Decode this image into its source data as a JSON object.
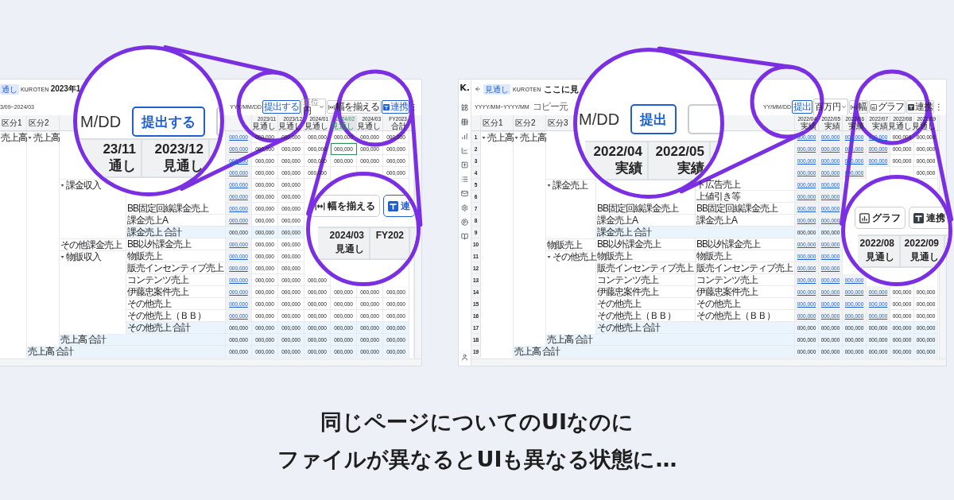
{
  "left_screen": {
    "badge": "通し",
    "company": "KUROTEN",
    "title": "2023年1",
    "period": "3/09~2024/03",
    "toolbar": {
      "date": "YYY/MM/DD",
      "submit": "提出する",
      "unit_label": "単位",
      "unit": "円",
      "buttons": [
        {
          "label": "幅を揃える",
          "kind": "align",
          "primary": false
        },
        {
          "label": "連携",
          "kind": "integration",
          "primary": true
        }
      ],
      "more": "⋮"
    },
    "label_headers": {
      "division_1": "区分1",
      "division_2": "区分2"
    },
    "columns": [
      {
        "actual": true,
        "selected": false
      },
      {
        "header": [
          "2023/11",
          "見通し"
        ],
        "actual": false,
        "selected": false
      },
      {
        "header": [
          "2023/12",
          "見通し"
        ],
        "actual": false,
        "selected": false
      },
      {
        "header": [
          "2024/01",
          "見通し"
        ],
        "actual": false,
        "selected": false
      },
      {
        "header": [
          "2024/02",
          "見通し"
        ],
        "actual": false,
        "selected": true
      },
      {
        "header": [
          "2024/03",
          "見通し"
        ],
        "actual": false,
        "selected": false
      },
      {
        "header": [
          "FY2023",
          "合計"
        ],
        "actual": false,
        "selected": false
      }
    ],
    "rows": [
      {
        "labels": {
          "division_1": {
            "text": "売上高"
          },
          "division_2": {
            "text": "売上高",
            "expanded": true
          }
        },
        "values": [
          "000,000",
          "000,000",
          "000,000",
          "000,000",
          "000,000",
          "000,000",
          "000,000"
        ],
        "total": false,
        "focused": false
      },
      {
        "values": [
          "000,000",
          "000,000",
          "000,000",
          "000,000",
          "000,000",
          "000,000",
          "000,000"
        ],
        "total": false,
        "focused": true
      },
      {
        "values": [
          "000,000",
          "000,000",
          "000,000",
          "000,000",
          "000,000",
          "000,000",
          "000,000"
        ],
        "total": false,
        "focused": false
      },
      {
        "values": [
          "000,000",
          "000,000",
          "000,000",
          "000,000"
        ],
        "tail_values": [
          "000,000"
        ],
        "total": false,
        "focused": false
      },
      {
        "labels": {
          "division_3": {
            "text": "課金収入",
            "expanded": true
          }
        },
        "values": [
          "000,000",
          "000,000",
          "000,000"
        ],
        "total": false,
        "focused": false
      },
      {
        "values": [
          "000,000",
          "000,000",
          "000,000"
        ],
        "total": false,
        "focused": false
      },
      {
        "labels": {
          "column_4": {
            "text": "BB固定回線課金売上"
          }
        },
        "values": [
          "000,000",
          "000,000",
          "000,000"
        ],
        "total": false,
        "focused": false
      },
      {
        "labels": {
          "column_4": {
            "text": "課金売上A"
          }
        },
        "values": [
          "000,000",
          "000,000",
          "000,000"
        ],
        "total": false,
        "focused": false
      },
      {
        "labels": {
          "column_4": {
            "text": "課金売上 合計"
          }
        },
        "values": [
          "000,000",
          "000,000",
          "000,000"
        ],
        "total": true,
        "focused": false
      },
      {
        "labels": {
          "division_3": {
            "text": "その他課金売上"
          },
          "column_4": {
            "text": "BB以外課金売上"
          }
        },
        "values": [
          "000,000",
          "000,000",
          "000,000"
        ],
        "total": false,
        "focused": false
      },
      {
        "labels": {
          "division_3": {
            "text": "物販収入",
            "expanded": true
          },
          "column_4": {
            "text": "物販売上"
          }
        },
        "values": [
          "000,000",
          "000,000",
          "000,000"
        ],
        "total": false,
        "focused": false
      },
      {
        "labels": {
          "column_4": {
            "text": "販売インセンティブ売上"
          }
        },
        "values": [
          "000,000",
          "000,000",
          "000,000"
        ],
        "total": false,
        "focused": false
      },
      {
        "labels": {
          "column_4": {
            "text": "コンテンツ売上"
          }
        },
        "values": [
          "000,000",
          "000,000",
          "000,000",
          "000,000"
        ],
        "total": false,
        "focused": false
      },
      {
        "labels": {
          "column_4": {
            "text": "伊藤忠案件売上"
          }
        },
        "values": [
          "000,000",
          "000,000",
          "000,000",
          "000,000",
          "000,000",
          "000,000",
          "000,000"
        ],
        "total": false,
        "focused": false
      },
      {
        "labels": {
          "column_4": {
            "text": "その他売上"
          }
        },
        "values": [
          "000,000",
          "000,000",
          "000,000",
          "000,000",
          "000,000",
          "000,000",
          "000,000"
        ],
        "total": false,
        "focused": false
      },
      {
        "labels": {
          "column_4": {
            "text": "その他売上（ＢＢ）"
          }
        },
        "values": [
          "000,000",
          "000,000",
          "000,000",
          "000,000",
          "000,000",
          "000,000",
          "000,000"
        ],
        "total": false,
        "focused": false
      },
      {
        "labels": {
          "column_4": {
            "text": "その他売上 合計"
          }
        },
        "values": [
          "000,000",
          "000,000",
          "000,000",
          "000,000",
          "000,000",
          "000,000",
          "000,000"
        ],
        "total": true,
        "focused": false
      },
      {
        "labels": {
          "division_3": {
            "text": "売上高 合計"
          }
        },
        "values": [
          "000,000",
          "000,000",
          "000,000",
          "000,000",
          "000,000",
          "000,000",
          "000,000"
        ],
        "total": true,
        "focused": false
      },
      {
        "labels": {
          "division_2": {
            "text": "売上高 合計"
          }
        },
        "values": [
          "000,000",
          "000,000",
          "000,000",
          "000,000",
          "000,000",
          "000,000",
          "000,000"
        ],
        "total": true,
        "focused": false
      }
    ],
    "lenses": [
      {
        "items": [
          {
            "kind": "text",
            "text": "M/DD"
          },
          {
            "kind": "submit",
            "label": "提出する",
            "primary": true
          },
          {
            "kind": "stub"
          }
        ],
        "headers": [
          [
            "23/11",
            "通し"
          ],
          [
            "2023/12",
            "見通し"
          ]
        ]
      },
      {
        "items": [
          {
            "kind": "align",
            "label": "幅を揃える",
            "primary": false
          },
          {
            "kind": "integration",
            "label": "連",
            "primary": true
          }
        ],
        "headers": [
          [
            "2024/03",
            "見通し"
          ],
          [
            "FY202"
          ]
        ]
      }
    ]
  },
  "right_screen": {
    "logo": "K.",
    "badge": "見通し",
    "company": "KUROTEN",
    "title": "ここに見",
    "period": "YYYY/MM~YYYY/MM",
    "copy_label": "コピー元",
    "toolbar": {
      "date": "YY/MM/DD",
      "submit": "提出",
      "unit": "百万円",
      "buttons": [
        {
          "label": "幅",
          "kind": "align",
          "primary": false
        },
        {
          "label": "グラフ",
          "kind": "chart",
          "primary": false
        },
        {
          "label": "連携",
          "kind": "integration",
          "primary": false
        }
      ],
      "more": "⋮"
    },
    "label_headers": {
      "division_1": "区分1",
      "division_2": "区分2",
      "division_3": "区分3"
    },
    "columns": [
      {
        "header": [
          "2022/04",
          "実績"
        ],
        "actual": true,
        "selected": false
      },
      {
        "header": [
          "2022/05",
          "実績"
        ],
        "actual": true,
        "selected": false
      },
      {
        "header": [
          "2022/06",
          "実績"
        ],
        "actual": true,
        "selected": false
      },
      {
        "header": [
          "2022/07",
          "実績"
        ],
        "actual": true,
        "selected": false
      },
      {
        "header": [
          "2022/08",
          "見通し"
        ],
        "actual": false,
        "selected": false
      },
      {
        "header": [
          "2022/09",
          "見通し"
        ],
        "actual": false,
        "selected": false
      }
    ],
    "rows": [
      {
        "number": "1",
        "labels": {
          "division_1": {
            "text": "売上高",
            "expanded": true
          },
          "division_2": {
            "text": "売上高",
            "expanded": true
          }
        },
        "values": [
          "000,000",
          "000,000",
          "000,000",
          "000,000",
          "000,000",
          "000,000"
        ],
        "total": false
      },
      {
        "number": "2",
        "values": [
          "000,000",
          "000,000",
          "000,000",
          "000,000",
          "000,000",
          "000,000"
        ],
        "total": false
      },
      {
        "number": "3",
        "values": [
          "000,000",
          "000,000",
          "000,000",
          "000,000",
          "000,000",
          "000,000"
        ],
        "total": false
      },
      {
        "number": "4",
        "values": [
          "000,000",
          "000,000",
          "000,000"
        ],
        "tail_values": [
          "000,000"
        ],
        "total": false
      },
      {
        "number": "5",
        "labels": {
          "division_3": {
            "text": "課金売上",
            "expanded": true
          },
          "column_5": {
            "text": "ト広告売上"
          }
        },
        "values": [
          "000,000",
          "000,000"
        ],
        "total": false
      },
      {
        "number": "6",
        "labels": {
          "column_5": {
            "text": "上値引き等"
          }
        },
        "values": [
          "000,000",
          "000,000"
        ],
        "total": false
      },
      {
        "number": "7",
        "labels": {
          "column_4": {
            "text": "BB固定回線課金売上"
          },
          "column_5": {
            "text": "BB固定回線課金売上"
          }
        },
        "values": [
          "000,000",
          "000,000"
        ],
        "total": false
      },
      {
        "number": "8",
        "labels": {
          "column_4": {
            "text": "課金売上A"
          },
          "column_5": {
            "text": "課金売上A"
          }
        },
        "values": [
          "000,000",
          "000,000"
        ],
        "total": false
      },
      {
        "number": "9",
        "labels": {
          "column_4": {
            "text": "課金売上 合計"
          }
        },
        "values": [
          "000,000",
          "000,000"
        ],
        "total": true
      },
      {
        "number": "10",
        "labels": {
          "division_3": {
            "text": "物販売上"
          },
          "column_4": {
            "text": "BB以外課金売上"
          },
          "column_5": {
            "text": "BB以外課金売上"
          }
        },
        "values": [
          "000,000",
          "000,000"
        ],
        "total": false
      },
      {
        "number": "11",
        "labels": {
          "division_3": {
            "text": "その他売上",
            "expanded": true
          },
          "column_4": {
            "text": "物販売上"
          },
          "column_5": {
            "text": "物販売上"
          }
        },
        "values": [
          "000,000",
          "000,000"
        ],
        "total": false
      },
      {
        "number": "12",
        "labels": {
          "column_4": {
            "text": "販売インセンティブ売上"
          },
          "column_5": {
            "text": "販売インセンティブ売上"
          }
        },
        "values": [
          "000,000",
          "000,000"
        ],
        "total": false
      },
      {
        "number": "13",
        "labels": {
          "column_4": {
            "text": "コンテンツ売上"
          },
          "column_5": {
            "text": "コンテンツ売上"
          }
        },
        "values": [
          "000,000",
          "000,000",
          "000,000"
        ],
        "total": false
      },
      {
        "number": "14",
        "labels": {
          "column_4": {
            "text": "伊藤忠案件売上"
          },
          "column_5": {
            "text": "伊藤忠案件売上"
          }
        },
        "values": [
          "000,000",
          "000,000",
          "000,000",
          "000,000",
          "000,000",
          "000,000"
        ],
        "total": false
      },
      {
        "number": "15",
        "labels": {
          "column_4": {
            "text": "その他売上"
          },
          "column_5": {
            "text": "その他売上"
          }
        },
        "values": [
          "000,000",
          "000,000",
          "000,000",
          "000,000",
          "000,000",
          "000,000"
        ],
        "total": false
      },
      {
        "number": "16",
        "labels": {
          "column_4": {
            "text": "その他売上（ＢＢ）"
          },
          "column_5": {
            "text": "その他売上（ＢＢ）"
          }
        },
        "values": [
          "000,000",
          "000,000",
          "000,000",
          "000,000",
          "000,000",
          "000,000"
        ],
        "total": false
      },
      {
        "number": "17",
        "labels": {
          "column_4": {
            "text": "その他売上 合計"
          }
        },
        "values": [
          "000,000",
          "000,000",
          "000,000",
          "000,000",
          "000,000",
          "000,000"
        ],
        "total": true
      },
      {
        "number": "18",
        "labels": {
          "division_3": {
            "text": "売上高 合計"
          }
        },
        "values": [
          "000,000",
          "000,000",
          "000,000",
          "000,000",
          "000,000",
          "000,000"
        ],
        "total": true
      },
      {
        "number": "19",
        "labels": {
          "division_2": {
            "text": "売上高 合計"
          }
        },
        "values": [
          "000,000",
          "000,000",
          "000,000",
          "000,000",
          "000,000",
          "000,000"
        ],
        "total": true
      }
    ],
    "lenses": [
      {
        "items": [
          {
            "kind": "text",
            "text": "M/DD"
          },
          {
            "kind": "submit",
            "label": "提出",
            "primary": true
          },
          {
            "kind": "stub"
          }
        ],
        "headers": [
          [
            "2022/04",
            "実績"
          ],
          [
            "2022/05",
            "実績"
          ]
        ]
      },
      {
        "items": [
          {
            "kind": "chart",
            "label": "グラフ",
            "primary": false
          },
          {
            "kind": "integration",
            "label": "連携",
            "primary": false
          }
        ],
        "headers": [
          [
            "2022/08",
            "見通し"
          ],
          [
            "2022/09",
            "見通し"
          ]
        ]
      }
    ]
  },
  "caption": [
    "同じページについてのUIなのに",
    "ファイルが異なるとUIも異なる状態に…"
  ]
}
